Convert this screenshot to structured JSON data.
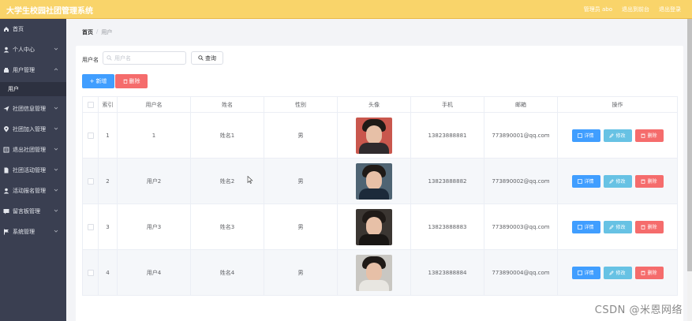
{
  "app": {
    "title": "大学生校园社团管理系统"
  },
  "header": {
    "actions": [
      "管理员 abo",
      "退出到前台",
      "退出登录"
    ]
  },
  "sidebar": {
    "items": [
      {
        "label": "首页",
        "icon": "home-icon",
        "expandable": false
      },
      {
        "label": "个人中心",
        "icon": "user-icon",
        "expandable": true
      },
      {
        "label": "用户管理",
        "icon": "users-icon",
        "expandable": true
      },
      {
        "label": "用户",
        "icon": "",
        "expandable": false,
        "sub": true
      },
      {
        "label": "社团信息管理",
        "icon": "send-icon",
        "expandable": true
      },
      {
        "label": "社团加入管理",
        "icon": "location-icon",
        "expandable": true
      },
      {
        "label": "退出社团管理",
        "icon": "list-icon",
        "expandable": true
      },
      {
        "label": "社团活动管理",
        "icon": "document-icon",
        "expandable": true
      },
      {
        "label": "活动报名管理",
        "icon": "person-icon",
        "expandable": true
      },
      {
        "label": "留言板管理",
        "icon": "message-icon",
        "expandable": true
      },
      {
        "label": "系统管理",
        "icon": "flag-icon",
        "expandable": true
      }
    ]
  },
  "breadcrumb": {
    "home": "首页",
    "separator": "/",
    "current": "用户"
  },
  "search": {
    "label": "用户名",
    "placeholder": "用户名",
    "value": "",
    "button": "查询"
  },
  "toolbar": {
    "add_label": "新增",
    "delete_label": "删除"
  },
  "table": {
    "columns": [
      "",
      "索引",
      "用户名",
      "姓名",
      "性别",
      "头像",
      "手机",
      "邮箱",
      "操作"
    ],
    "rows": [
      {
        "index": "1",
        "username": "1",
        "name": "姓名1",
        "gender": "男",
        "phone": "13823888881",
        "email": "773890001@qq.com"
      },
      {
        "index": "2",
        "username": "用户2",
        "name": "姓名2",
        "gender": "男",
        "phone": "13823888882",
        "email": "773890002@qq.com"
      },
      {
        "index": "3",
        "username": "用户3",
        "name": "姓名3",
        "gender": "男",
        "phone": "13823888883",
        "email": "773890003@qq.com"
      },
      {
        "index": "4",
        "username": "用户4",
        "name": "姓名4",
        "gender": "男",
        "phone": "13823888884",
        "email": "773890004@qq.com"
      }
    ],
    "actions": {
      "detail": "详情",
      "edit": "修改",
      "remove": "删除"
    }
  },
  "colors": {
    "header": "#f9d46a",
    "sidebar": "#3a3f51",
    "primary": "#409eff",
    "danger": "#f56c6c",
    "info": "#67c2e4"
  },
  "watermark": "CSDN @米恩网络"
}
